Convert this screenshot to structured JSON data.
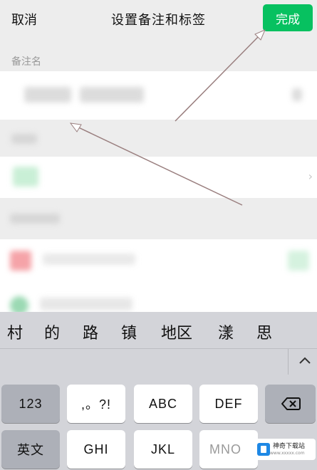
{
  "nav": {
    "cancel": "取消",
    "title": "设置备注和标签",
    "done": "完成"
  },
  "remark": {
    "section_label": "备注名"
  },
  "candidates": {
    "items": [
      "村",
      "的",
      "路",
      "镇",
      "地区",
      "漾",
      "思"
    ],
    "expand_icon": "chevron-up-icon"
  },
  "keyboard": {
    "row1": [
      "123",
      ",。?!",
      "ABC",
      "DEF"
    ],
    "row2": [
      "英文",
      "GHI",
      "JKL",
      "MNO"
    ],
    "delete_icon": "backspace-icon"
  },
  "watermark": {
    "text": "神奇下载站",
    "sub": "www.xxxxx.com"
  },
  "colors": {
    "accent": "#07c160",
    "background": "#ededed",
    "keyboard": "#d3d4d9"
  }
}
